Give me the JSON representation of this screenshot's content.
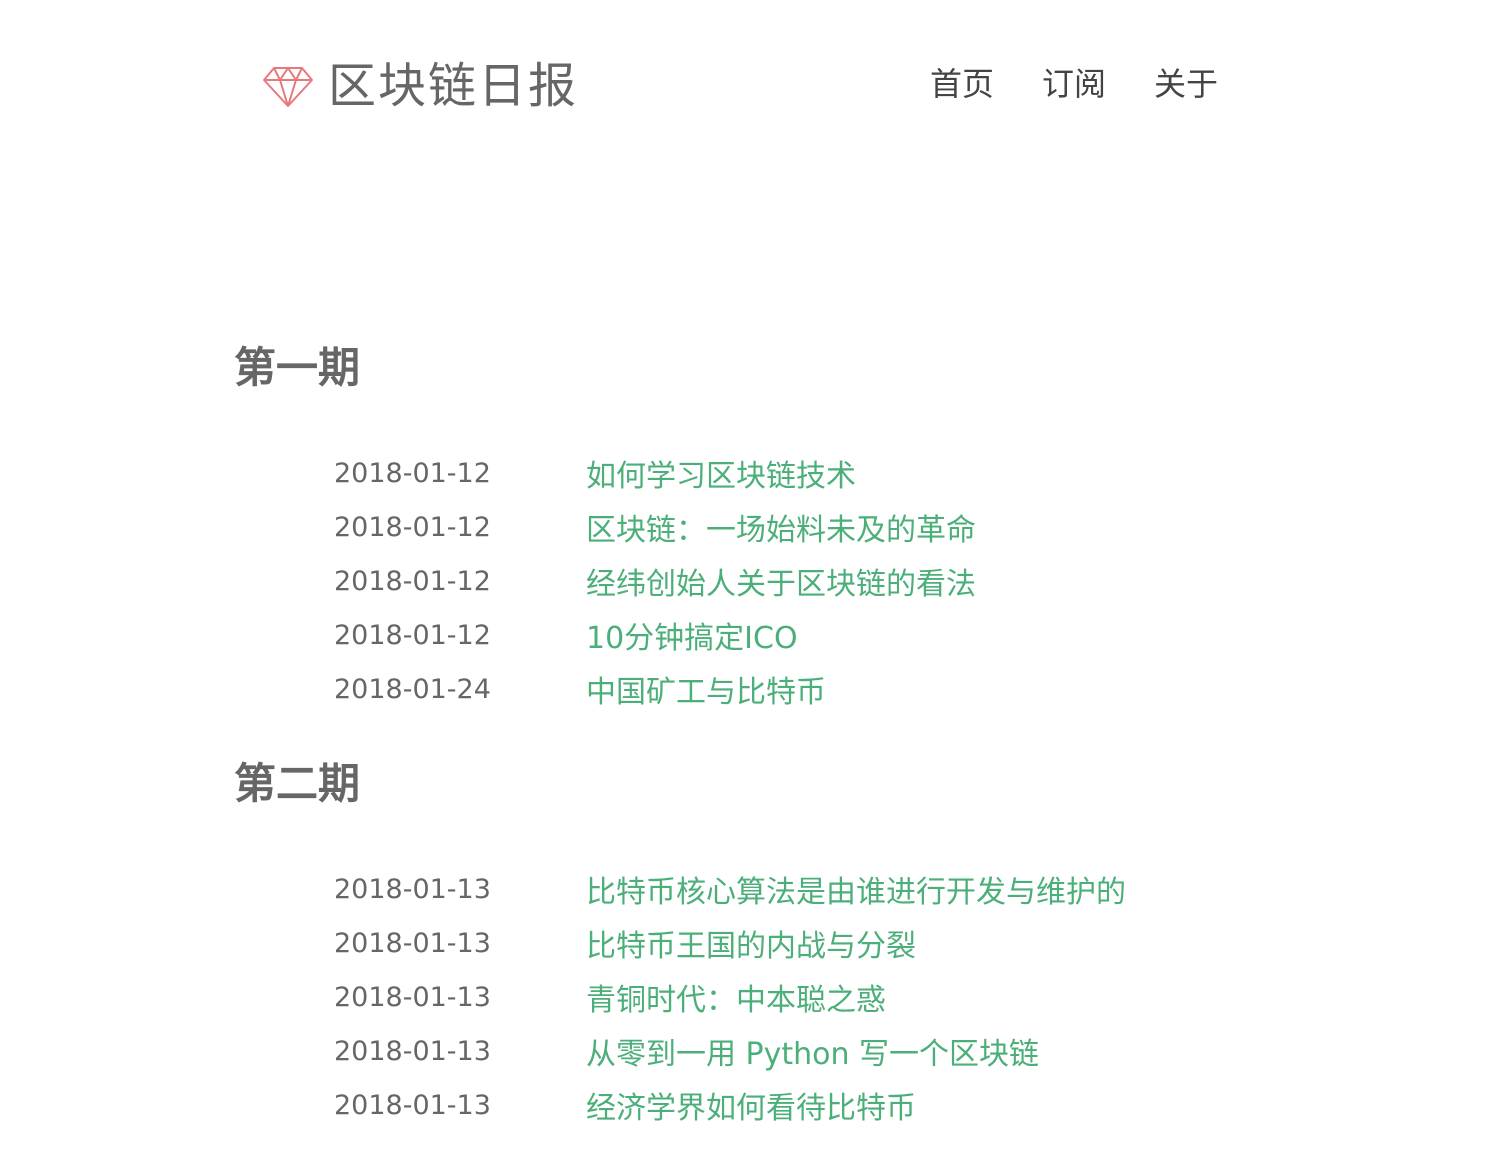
{
  "header": {
    "logo_icon": "diamond-icon",
    "site_title": "区块链日报",
    "nav": [
      "首页",
      "订阅",
      "关于"
    ]
  },
  "issues": [
    {
      "title": "第一期",
      "posts": [
        {
          "date": "2018-01-12",
          "title": "如何学习区块链技术"
        },
        {
          "date": "2018-01-12",
          "title": "区块链：一场始料未及的革命"
        },
        {
          "date": "2018-01-12",
          "title": "经纬创始人关于区块链的看法"
        },
        {
          "date": "2018-01-12",
          "title": "10分钟搞定ICO"
        },
        {
          "date": "2018-01-24",
          "title": "中国矿工与比特币"
        }
      ]
    },
    {
      "title": "第二期",
      "posts": [
        {
          "date": "2018-01-13",
          "title": "比特币核心算法是由谁进行开发与维护的"
        },
        {
          "date": "2018-01-13",
          "title": "比特币王国的内战与分裂"
        },
        {
          "date": "2018-01-13",
          "title": "青铜时代：中本聪之惑"
        },
        {
          "date": "2018-01-13",
          "title": "从零到一用 Python 写一个区块链"
        },
        {
          "date": "2018-01-13",
          "title": "经济学界如何看待比特币"
        }
      ]
    }
  ],
  "colors": {
    "accent": "#4caf79",
    "logo_icon": "#e8787a",
    "text_muted": "#666666"
  }
}
